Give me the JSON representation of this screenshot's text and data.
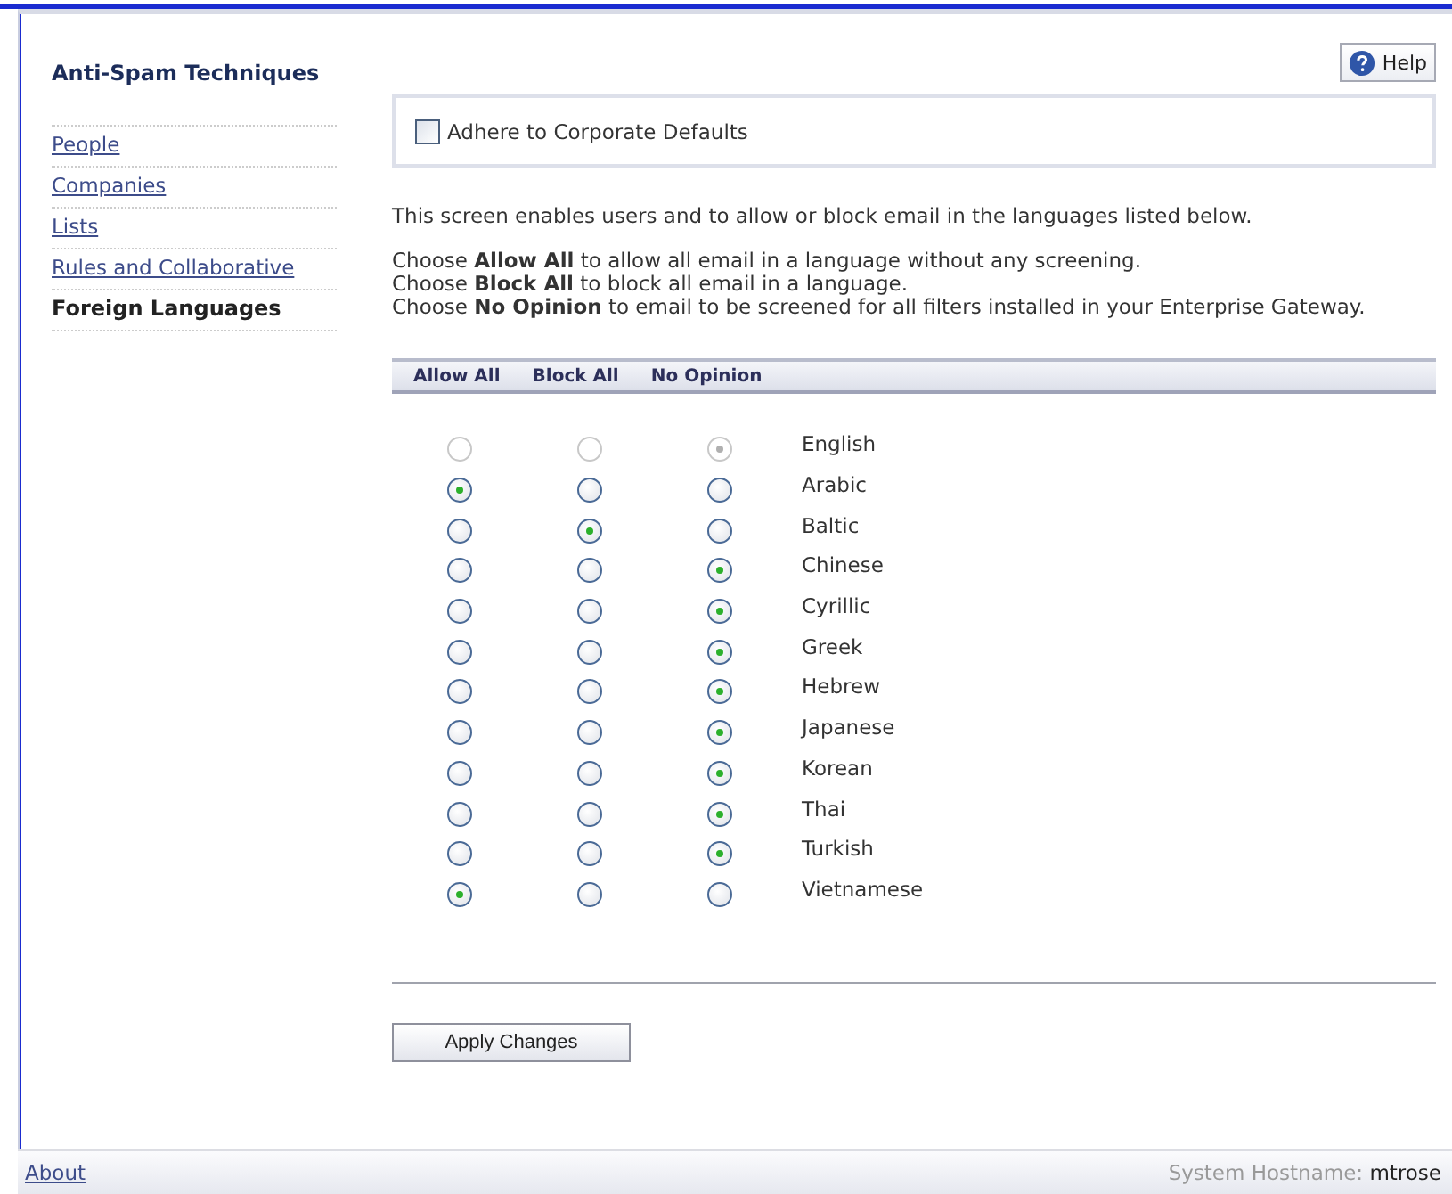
{
  "sidebar": {
    "title": "Anti-Spam Techniques",
    "items": [
      {
        "label": "People",
        "selected": false
      },
      {
        "label": "Companies",
        "selected": false
      },
      {
        "label": "Lists",
        "selected": false
      },
      {
        "label": "Rules and Collaborative",
        "selected": false
      },
      {
        "label": "Foreign Languages",
        "selected": true
      }
    ]
  },
  "help_button": "Help",
  "corporate_defaults": {
    "label": "Adhere to Corporate Defaults",
    "checked": false
  },
  "intro": "This screen enables users and to allow or block email in the languages listed below.",
  "instructions": [
    "Choose **Allow All** to allow all email in a language without any screening.",
    "Choose **Block All** to block all email in a language.",
    "Choose **No Opinion** to email to be screened for all filters installed in your Enterprise Gateway."
  ],
  "table": {
    "columns": [
      "Allow All",
      "Block All",
      "No Opinion"
    ],
    "rows": [
      {
        "language": "English",
        "disabled": true,
        "options": [
          {
            "selected": false
          },
          {
            "selected": false
          },
          {
            "selected": true
          }
        ]
      },
      {
        "language": "Arabic",
        "disabled": false,
        "options": [
          {
            "selected": true
          },
          {
            "selected": false
          },
          {
            "selected": false
          }
        ]
      },
      {
        "language": "Baltic",
        "disabled": false,
        "options": [
          {
            "selected": false
          },
          {
            "selected": true
          },
          {
            "selected": false
          }
        ]
      },
      {
        "language": "Chinese",
        "disabled": false,
        "options": [
          {
            "selected": false
          },
          {
            "selected": false
          },
          {
            "selected": true
          }
        ]
      },
      {
        "language": "Cyrillic",
        "disabled": false,
        "options": [
          {
            "selected": false
          },
          {
            "selected": false
          },
          {
            "selected": true
          }
        ]
      },
      {
        "language": "Greek",
        "disabled": false,
        "options": [
          {
            "selected": false
          },
          {
            "selected": false
          },
          {
            "selected": true
          }
        ]
      },
      {
        "language": "Hebrew",
        "disabled": false,
        "options": [
          {
            "selected": false
          },
          {
            "selected": false
          },
          {
            "selected": true
          }
        ]
      },
      {
        "language": "Japanese",
        "disabled": false,
        "options": [
          {
            "selected": false
          },
          {
            "selected": false
          },
          {
            "selected": true
          }
        ]
      },
      {
        "language": "Korean",
        "disabled": false,
        "options": [
          {
            "selected": false
          },
          {
            "selected": false
          },
          {
            "selected": true
          }
        ]
      },
      {
        "language": "Thai",
        "disabled": false,
        "options": [
          {
            "selected": false
          },
          {
            "selected": false
          },
          {
            "selected": true
          }
        ]
      },
      {
        "language": "Turkish",
        "disabled": false,
        "options": [
          {
            "selected": false
          },
          {
            "selected": false
          },
          {
            "selected": true
          }
        ]
      },
      {
        "language": "Vietnamese",
        "disabled": false,
        "options": [
          {
            "selected": true
          },
          {
            "selected": false
          },
          {
            "selected": false
          }
        ]
      }
    ]
  },
  "apply_button": "Apply Changes",
  "status_bar": {
    "about": "About",
    "hostname_label": "System Hostname:",
    "hostname": "mtrose"
  }
}
